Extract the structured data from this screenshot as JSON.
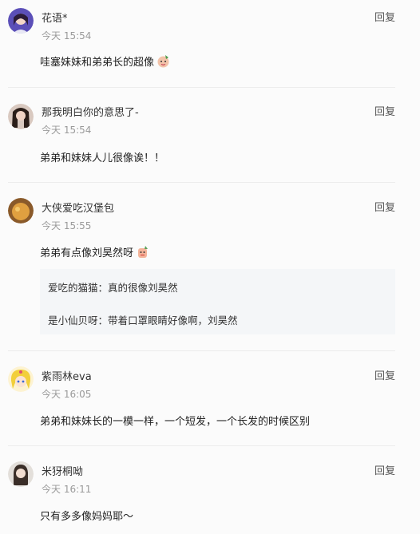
{
  "reply_label": "回复",
  "comments": [
    {
      "name": "花语*",
      "time": "今天 15:54",
      "text": "哇塞妹妹和弟弟长的超像",
      "emoji": "emoji-sticker-icon"
    },
    {
      "name": "那我明白你的意思了-",
      "time": "今天 15:54",
      "text": "弟弟和妹妹人儿很像诶！！"
    },
    {
      "name": "大侠爱吃汉堡包",
      "time": "今天 15:55",
      "text": "弟弟有点像刘昊然呀",
      "emoji": "emoji-sticker-icon",
      "replies": [
        {
          "author": "爱吃的猫猫",
          "text": "真的很像刘昊然"
        },
        {
          "author": "是小仙贝呀",
          "text": "带着口罩眼睛好像啊，刘昊然"
        }
      ]
    },
    {
      "name": "紫雨林eva",
      "time": "今天 16:05",
      "text": "弟弟和妹妹长的一模一样，一个短发，一个长发的时候区别"
    },
    {
      "name": "米犽桐呦",
      "time": "今天 16:11",
      "text": "只有多多像妈妈耶～"
    }
  ],
  "colors": {
    "background": "#fbfbfb",
    "divider": "#ececec",
    "time": "#9a9a9a",
    "subbox": "#f4f6f8"
  }
}
